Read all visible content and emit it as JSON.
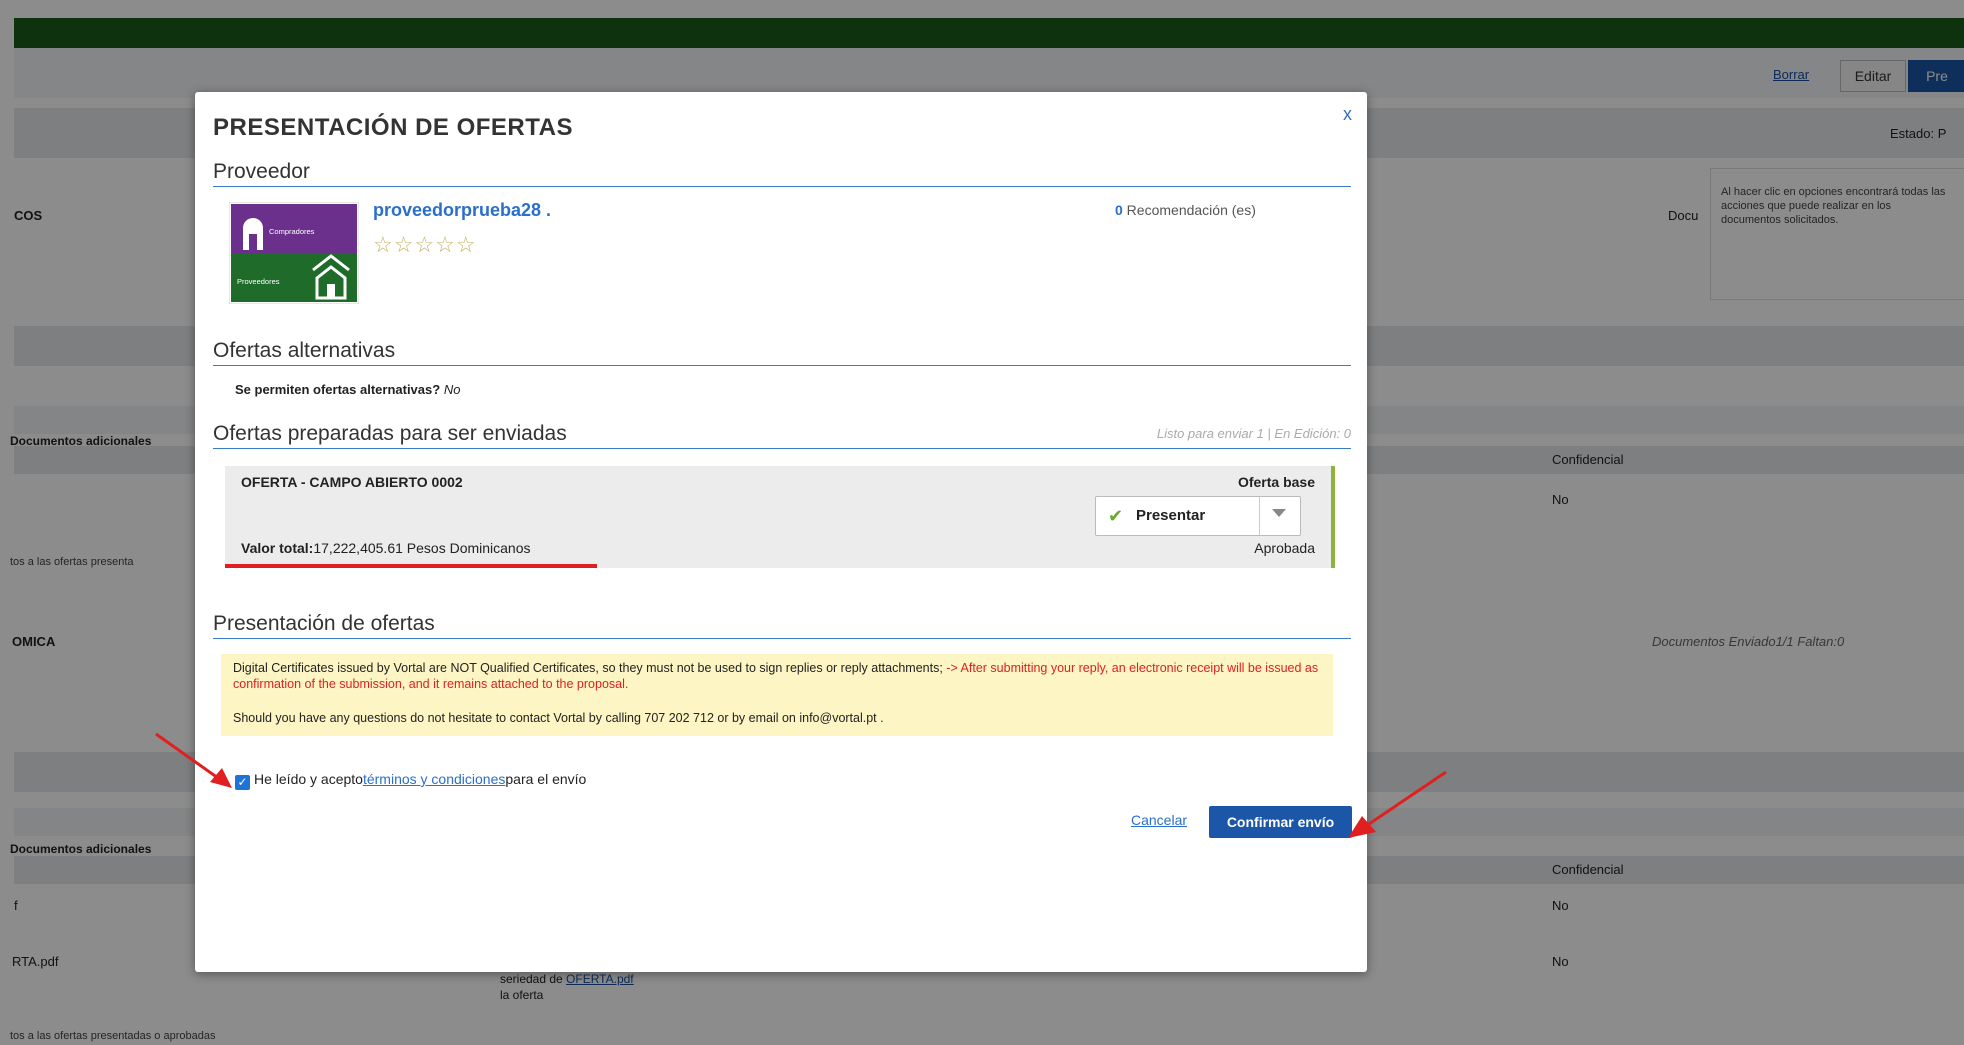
{
  "background": {
    "toolbar": {
      "delete_label": "Borrar",
      "edit_label": "Editar",
      "primary_label": "Pre"
    },
    "state_label": "Estado: P",
    "row_cos": "COS",
    "doc_link_partial": "Docu",
    "tooltip": "Al hacer clic en opciones encontrará todas las acciones que puede realizar en los documentos solicitados.",
    "additional_docs_1": "Documentos adicionales",
    "confidential_1": "Confidencial",
    "no_1": "No",
    "presented_offers_note_1": "tos a las ofertas presenta",
    "row_omica": "OMICA",
    "docs_status": "Documentos  Enviado1/1  Faltan:0",
    "additional_docs_2": "Documentos adicionales",
    "confidential_2": "Confidencial",
    "row_f": "f",
    "no_2": "No",
    "row_rta_pdf": "RTA.pdf",
    "seriedad_line1": "seriedad de ",
    "seriedad_link": "OFERTA.pdf",
    "seriedad_line2": "la oferta",
    "no_3": "No",
    "presented_offers_note_2": "tos a las ofertas presentadas o aprobadas"
  },
  "modal": {
    "title": "PRESENTACIÓN DE OFERTAS",
    "close_glyph": "x",
    "supplier": {
      "heading": "Proveedor",
      "logo_top_label": "Compradores",
      "logo_bottom_label": "Proveedores",
      "name": "proveedorprueba28 .",
      "stars": "☆☆☆☆☆",
      "recommendations_count": "0",
      "recommendations_label": " Recomendación (es)"
    },
    "alternatives": {
      "heading": "Ofertas alternativas",
      "question": "Se permiten ofertas alternativas?",
      "answer": "No"
    },
    "prepared": {
      "heading": "Ofertas preparadas para ser enviadas",
      "status": "Listo para enviar 1 | En Edición: 0",
      "offer": {
        "title": "OFERTA - CAMPO ABIERTO 0002",
        "type": "Oferta base",
        "action_label": "Presentar",
        "value_label": "Valor total:",
        "value": "17,222,405.61 Pesos Dominicanos",
        "status": "Aprobada"
      }
    },
    "submission": {
      "heading": "Presentación de ofertas",
      "notice_black": "Digital Certificates issued by Vortal are NOT Qualified Certificates, so they must not be used to sign replies or reply attachments;",
      "notice_red": " -> After submitting your reply, an electronic receipt will be issued as confirmation of the submission, and it remains attached to the proposal.",
      "notice_contact": "Should you have any questions do not hesitate to contact Vortal by calling 707 202 712 or by email on info@vortal.pt .",
      "agree_before": "He leído y acepto",
      "agree_link": "términos y condiciones",
      "agree_after": "para el envío",
      "cancel_label": "Cancelar",
      "confirm_label": "Confirmar envío"
    }
  },
  "colors": {
    "accent_blue": "#1b56a8",
    "top_bar_green": "#1d5c1a",
    "annotation_red": "#e02020",
    "approved_green": "#8db33a"
  }
}
